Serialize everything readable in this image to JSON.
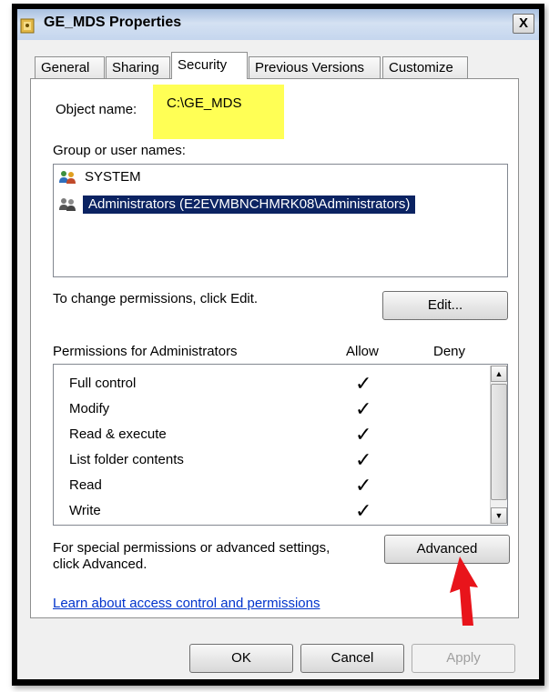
{
  "window": {
    "title": "GE_MDS Properties",
    "close_label": "X"
  },
  "tabs": [
    {
      "label": "General"
    },
    {
      "label": "Sharing"
    },
    {
      "label": "Security"
    },
    {
      "label": "Previous Versions"
    },
    {
      "label": "Customize"
    }
  ],
  "object": {
    "label": "Object name:",
    "value": "C:\\GE_MDS"
  },
  "groups": {
    "label": "Group or user names:",
    "users": [
      {
        "name": "SYSTEM",
        "selected": false
      },
      {
        "name": "Administrators (E2EVMBNCHMRK08\\Administrators)",
        "selected": true
      }
    ]
  },
  "change": {
    "label": "To change permissions, click Edit.",
    "edit_button": "Edit..."
  },
  "permissions": {
    "header": "Permissions for Administrators",
    "allow_header": "Allow",
    "deny_header": "Deny",
    "rows": [
      {
        "name": "Full control",
        "allow": "✓",
        "deny": ""
      },
      {
        "name": "Modify",
        "allow": "✓",
        "deny": ""
      },
      {
        "name": "Read & execute",
        "allow": "✓",
        "deny": ""
      },
      {
        "name": "List folder contents",
        "allow": "✓",
        "deny": ""
      },
      {
        "name": "Read",
        "allow": "✓",
        "deny": ""
      },
      {
        "name": "Write",
        "allow": "✓",
        "deny": ""
      }
    ]
  },
  "special": {
    "line1": "For special permissions or advanced settings,",
    "line2": "click Advanced.",
    "advanced_button": "Advanced"
  },
  "learn_link": "Learn about access control and permissions",
  "footer": {
    "ok": "OK",
    "cancel": "Cancel",
    "apply": "Apply"
  },
  "colors": {
    "highlight": "#ffff55",
    "selection": "#0b2362",
    "link": "#0033cc",
    "arrow": "#e8141b"
  }
}
